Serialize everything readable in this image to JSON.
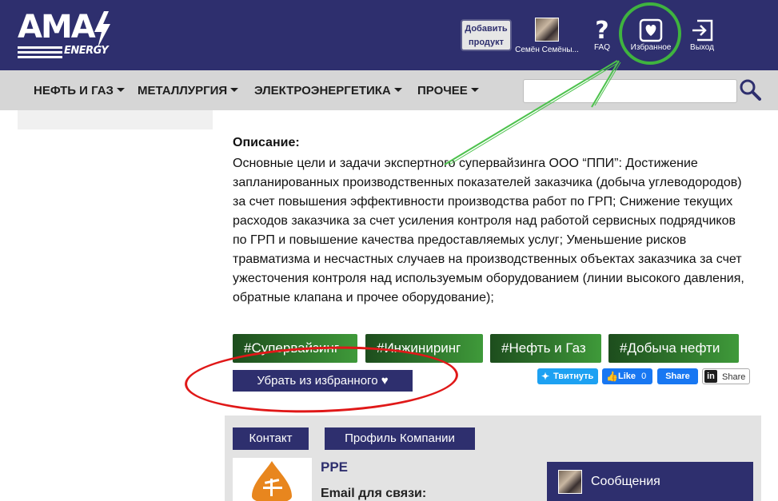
{
  "header": {
    "logo": {
      "main": "AMA",
      "sub": "ENERGY"
    },
    "add_product": {
      "line1": "Добавить",
      "line2": "продукт"
    },
    "user": {
      "name": "Семён Семёны..."
    },
    "faq": {
      "glyph": "?",
      "label": "FAQ"
    },
    "favorites": {
      "label": "Избранное",
      "icon": "heart-icon"
    },
    "exit": {
      "label": "Выход",
      "icon": "logout-icon"
    }
  },
  "nav": {
    "items": [
      {
        "label": "НЕФТЬ И ГАЗ"
      },
      {
        "label": "МЕТАЛЛУРГИЯ"
      },
      {
        "label": "ЭЛЕКТРОЭНЕРГЕТИКА"
      },
      {
        "label": "ПРОЧЕЕ"
      }
    ],
    "search": {
      "placeholder": "",
      "value": ""
    }
  },
  "content": {
    "heading": "Описание:",
    "body": "Основные цели и задачи экспертного супервайзинга ООО “ППИ”: Достижение запланированных производственных показателей заказчика (добыча углеводородов) за счет повышения эффективности производства работ по ГРП; Снижение текущих расходов заказчика за счет усиления контроля над работой сервисных подрядчиков по ГРП и повышение качества предоставляемых услуг; Уменьшение рисков травматизма и несчастных случаев на производственных объектах заказчика за счет ужесточения контроля над используемым оборудованием (линии высокого давления, обратные клапана и прочее оборудование);",
    "tags": [
      "#Супервайзинг",
      "#Инжиниринг",
      "#Нефть и Газ",
      "#Добыча нефти"
    ],
    "remove_favorite": "Убрать из избранного",
    "share": {
      "twitter": "Твитнуть",
      "fb_like": "Like",
      "fb_like_count": "0",
      "fb_share": "Share",
      "linkedin": "Share"
    }
  },
  "company": {
    "tabs": [
      "Контакт",
      "Профиль Компании"
    ],
    "name": "PPE",
    "email_label": "Email для связи:"
  },
  "messages": {
    "label": "Сообщения"
  },
  "colors": {
    "primary": "#2e2f6e",
    "tag_dark": "#1d4d1d",
    "tag_light": "#3f9a3a",
    "annotation_green": "#3fb33f",
    "annotation_red": "#e01818"
  }
}
